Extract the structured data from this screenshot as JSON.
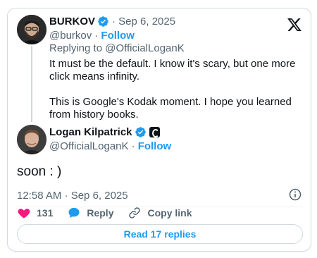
{
  "parent_tweet": {
    "display_name": "BURKOV",
    "date": "· Sep 6, 2025",
    "handle": "@burkov ·",
    "follow_label": "Follow",
    "replying_to": "Replying to @OfficialLoganK",
    "text_paragraph_1": "It must be the default. I know it's scary, but one more click means infinity.",
    "text_paragraph_2": "This is Google's Kodak moment. I hope you learned from history books."
  },
  "main_tweet": {
    "display_name": "Logan Kilpatrick",
    "handle": "@OfficialLoganK ·",
    "follow_label": "Follow",
    "text": "soon : )",
    "timestamp": "12:58 AM · Sep 6, 2025"
  },
  "actions": {
    "likes": "131",
    "reply_label": "Reply",
    "copy_label": "Copy link"
  },
  "read_replies_label": "Read 17 replies",
  "icons": {
    "platform": "x-logo-icon",
    "verified": "verified-badge-icon",
    "affiliation": "affiliation-badge-icon",
    "info": "info-icon",
    "like": "heart-icon",
    "reply": "speech-bubble-icon",
    "copy": "link-icon"
  },
  "colors": {
    "accent": "#1d9bf0",
    "like": "#f91880",
    "text": "#0f1419",
    "muted": "#536471",
    "border": "#cfd9de"
  }
}
